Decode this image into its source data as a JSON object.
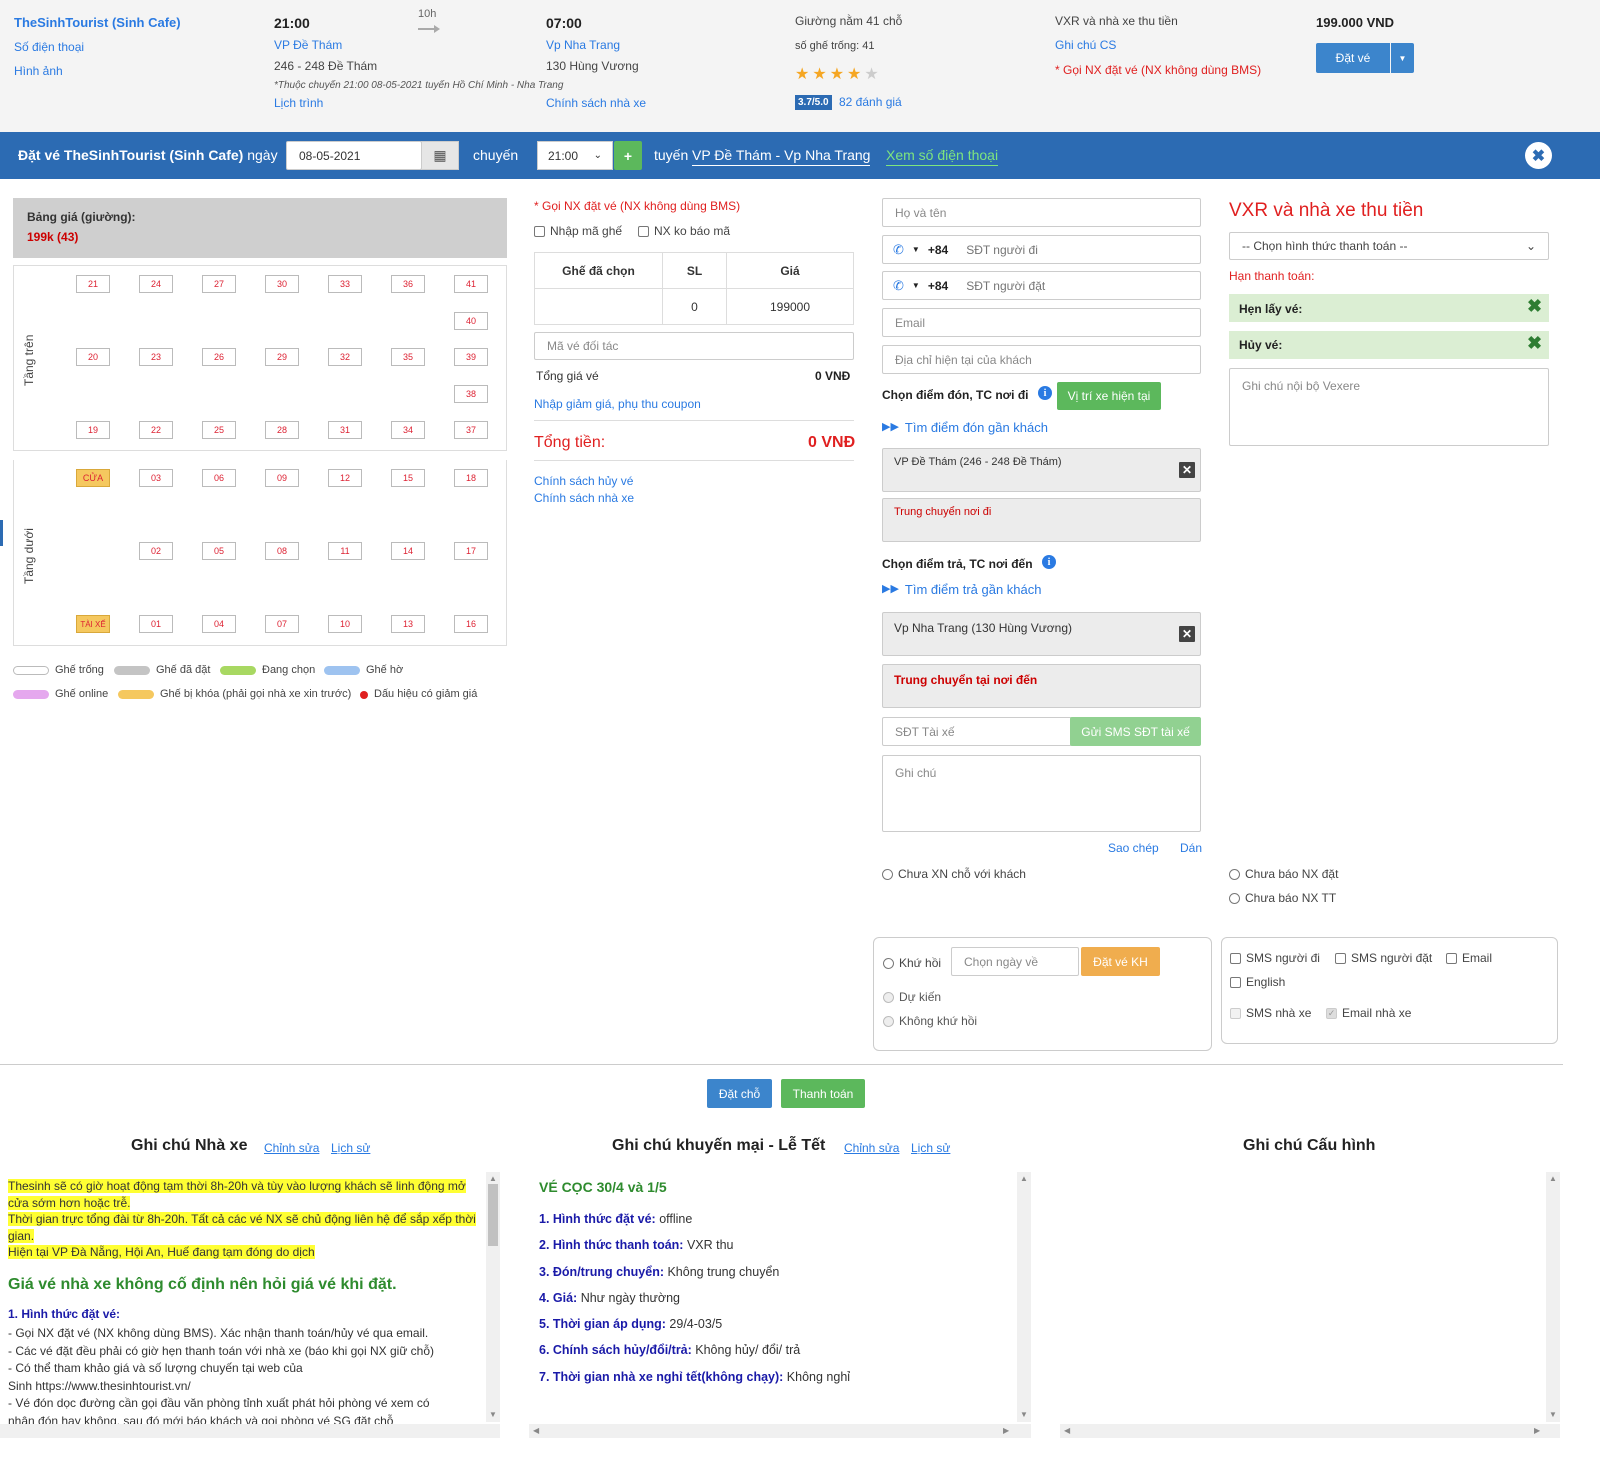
{
  "trip": {
    "operator": "TheSinhTourist (Sinh Cafe)",
    "phone_link": "Số điện thoại",
    "images_link": "Hình ảnh",
    "depart_time": "21:00",
    "duration": "10h",
    "arrive_time": "07:00",
    "depart_place": "VP Đề Thám",
    "depart_address": "246 - 248 Đề Thám",
    "arrive_place": "Vp Nha Trang",
    "arrive_address": "130 Hùng Vương",
    "note": "*Thuộc chuyến 21:00 08-05-2021 tuyến Hồ Chí Minh - Nha Trang",
    "schedule_link": "Lịch trình",
    "policy_link": "Chính sách nhà xe",
    "bus_type": "Giường nằm 41 chỗ",
    "empty_seats": "số ghế trống: 41",
    "rating_badge": "3.7/5.0",
    "reviews": "82 đánh giá",
    "payment": "VXR và nhà xe thu tiền",
    "cs_note": "Ghi chú CS",
    "call_note": "* Gọi NX đặt vé (NX không dùng BMS)",
    "price": "199.000 VND",
    "book_button": "Đặt vé"
  },
  "bar": {
    "prefix": "Đặt vé",
    "operator": "TheSinhTourist (Sinh Cafe)",
    "day_label": "ngày",
    "date": "08-05-2021",
    "trip_label": "chuyến",
    "time": "21:00",
    "route_label": "tuyến",
    "route": "VP Đề Thám - Vp Nha Trang",
    "phone_link": "Xem số điện thoại"
  },
  "price_table": {
    "title": "Bảng giá (giường):",
    "value": "199k (43)"
  },
  "decks": {
    "upper_label": "Tầng trên",
    "lower_label": "Tầng dưới"
  },
  "upper_seats": [
    [
      "21",
      "24",
      "27",
      "30",
      "33",
      "36",
      "41"
    ],
    [
      "",
      "",
      "",
      "",
      "",
      "",
      "40"
    ],
    [
      "20",
      "23",
      "26",
      "29",
      "32",
      "35",
      "39"
    ],
    [
      "",
      "",
      "",
      "",
      "",
      "",
      "38"
    ],
    [
      "19",
      "22",
      "25",
      "28",
      "31",
      "34",
      "37"
    ]
  ],
  "lower_seats": [
    [
      "CỬA",
      "03",
      "06",
      "09",
      "12",
      "15",
      "18"
    ],
    [
      "",
      "02",
      "05",
      "08",
      "11",
      "14",
      "17"
    ],
    [
      "TÀI XẾ",
      "01",
      "04",
      "07",
      "10",
      "13",
      "16"
    ]
  ],
  "legend": [
    {
      "label": "Ghế trống",
      "color": "#ffffff"
    },
    {
      "label": "Ghế đã đặt",
      "color": "#c4c4c4"
    },
    {
      "label": "Đang chọn",
      "color": "#a8d862"
    },
    {
      "label": "Ghế hờ",
      "color": "#9ec3f0"
    },
    {
      "label": "Ghế online",
      "color": "#e5a8ee"
    },
    {
      "label": "Ghế bị khóa (phải gọi nhà xe xin trước)",
      "color": "#f5c85f"
    },
    {
      "label": "Dấu hiệu có giảm giá",
      "color": "#e02020"
    }
  ],
  "booking": {
    "call_note": "* Gọi NX đặt vé (NX không dùng BMS)",
    "enter_seat_code": "Nhập mã ghế",
    "no_report_code": "NX ko báo mã",
    "col_seats": "Ghế đã chọn",
    "col_qty": "SL",
    "col_price": "Giá",
    "seats_value": "",
    "qty_value": "0",
    "price_value": "199000",
    "partner_code_placeholder": "Mã vé đối tác",
    "total_ticket_label": "Tổng giá vé",
    "total_ticket_value": "0 VNĐ",
    "coupon_link": "Nhập giảm giá, phụ thu coupon",
    "grand_total_label": "Tổng tiền:",
    "grand_total_value": "0 VNĐ",
    "cancel_policy": "Chính sách hủy vé",
    "operator_policy": "Chính sách nhà xe"
  },
  "customer": {
    "name_placeholder": "Họ và tên",
    "country_code": "+84",
    "traveler_phone_placeholder": "SĐT người đi",
    "booker_phone_placeholder": "SĐT người đặt",
    "email_placeholder": "Email",
    "address_placeholder": "Địa chỉ hiện tại của khách",
    "pickup_label": "Chọn điểm đón, TC nơi đi",
    "current_location_button": "Vị trí xe hiện tại",
    "find_pickup": "Tìm điểm đón gần khách",
    "pickup_value": "VP Đề Thám (246 - 248 Đề Thám)",
    "transfer_from": "Trung chuyển nơi đi",
    "dropoff_label": "Chọn điểm trả, TC nơi đến",
    "find_dropoff": "Tìm điểm trả gần khách",
    "dropoff_value": "Vp Nha Trang  (130 Hùng Vương)",
    "transfer_to": "Trung chuyển tại nơi đến",
    "driver_phone_placeholder": "SĐT Tài xế",
    "send_sms_button": "Gửi SMS SĐT tài xế",
    "note_placeholder": "Ghi chú",
    "copy_link": "Sao chép",
    "paste_link": "Dán",
    "unconfirmed": "Chưa XN chỗ với khách"
  },
  "payment_panel": {
    "title": "VXR và nhà xe thu tiền",
    "method_placeholder": "-- Chọn hình thức thanh toán --",
    "deadline_label": "Hạn thanh toán:",
    "appointment_label": "Hẹn lấy vé:",
    "cancel_label": "Hủy vé:",
    "internal_note_placeholder": "Ghi chú nội bộ Vexere",
    "not_reported_nx": "Chưa báo NX đặt",
    "not_reported_tt": "Chưa báo NX TT"
  },
  "return_trip": {
    "round_trip": "Khứ hồi",
    "date_placeholder": "Chọn ngày về",
    "book_button": "Đặt vé KH",
    "tentative": "Dự kiến",
    "one_way": "Không khứ hồi"
  },
  "notify": {
    "sms_traveler": "SMS người đi",
    "sms_booker": "SMS người đặt",
    "email": "Email",
    "english": "English",
    "sms_operator": "SMS nhà xe",
    "email_operator": "Email nhà xe"
  },
  "actions": {
    "reserve": "Đặt chỗ",
    "pay": "Thanh toán"
  },
  "notes": {
    "operator_title": "Ghi chú Nhà xe",
    "edit": "Chỉnh sửa",
    "history": "Lịch sử",
    "promo_title": "Ghi chú khuyến mại - Lễ Tết",
    "config_title": "Ghi chú Cấu hình",
    "operator_highlights": [
      "Thesinh sẽ có giờ hoạt động tạm thời 8h-20h và tùy vào lượng khách sẽ linh động mở",
      "cửa sớm hơn hoặc trễ.",
      "Thời gian trực tổng đài từ 8h-20h. Tất cả các vé NX sẽ chủ động liên hệ để sắp xếp thời",
      "gian.",
      "Hiện tại VP Đà Nẵng, Hội An, Huế đang tạm đóng do dịch"
    ],
    "operator_heading": "Giá vé nhà xe không cố định nên hỏi giá vé khi đặt.",
    "operator_subheading": "1. Hình thức đặt vé:",
    "operator_lines": [
      "- Gọi NX đặt vé (NX không dùng BMS). Xác nhận thanh toán/hủy vé qua email.",
      "- Các vé đặt đều phải có giờ hẹn thanh toán với nhà xe (báo khi gọi NX giữ chỗ)",
      "- Có thể tham khảo giá và số lượng chuyến tại web của",
      "Sinh https://www.thesinhtourist.vn/",
      "- Vé đón dọc đường cần gọi đầu văn phòng tỉnh xuất phát hỏi phòng vé xem có",
      "nhận đón hay không, sau đó mới báo khách và gọi phòng vé SG đặt chỗ"
    ],
    "promo_heading": "VÉ CỌC 30/4 và 1/5",
    "promo_items": [
      {
        "label": "1. Hình thức đặt vé:",
        "value": " offline"
      },
      {
        "label": "2. Hình thức thanh toán:",
        "value": " VXR thu"
      },
      {
        "label": "3. Đón/trung chuyển:",
        "value": " Không trung chuyển"
      },
      {
        "label": "4. Giá:",
        "value": " Như ngày thường"
      },
      {
        "label": "5. Thời gian áp dụng:",
        "value": " 29/4-03/5"
      },
      {
        "label": "6. Chính sách hủy/đổi/trả:",
        "value": " Không hủy/ đổi/ trả"
      },
      {
        "label": "7. Thời gian nhà xe nghỉ tết(không chạy):",
        "value": " Không nghỉ"
      }
    ]
  }
}
